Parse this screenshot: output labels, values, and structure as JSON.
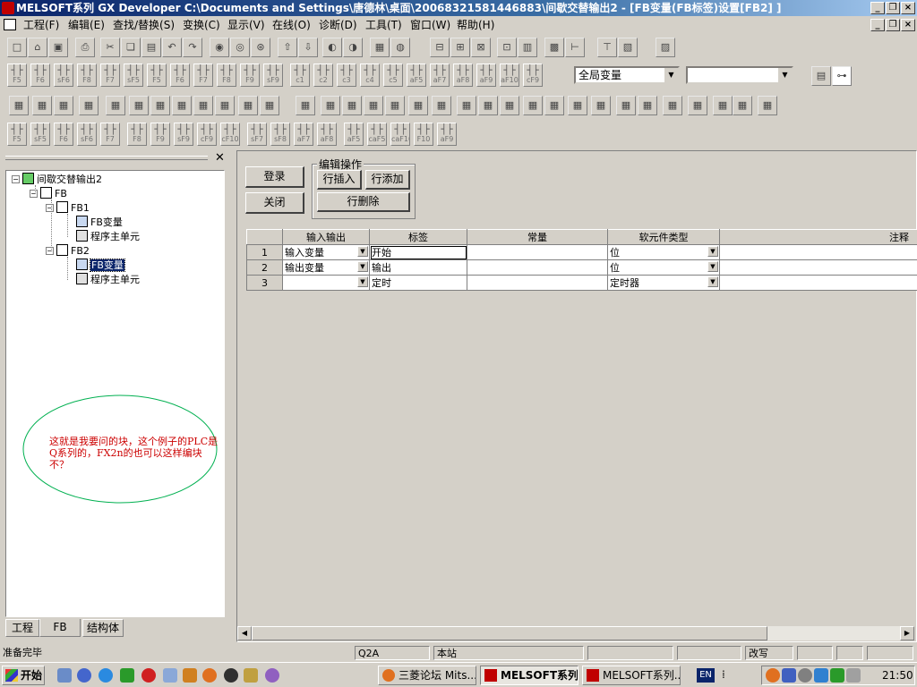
{
  "window": {
    "title": "MELSOFT系列 GX Developer C:\\Documents and Settings\\唐德林\\桌面\\20068321581446883\\间歇交替输出2 - [FB变量(FB标签)设置[FB2] ]"
  },
  "menu": [
    "工程(F)",
    "编辑(E)",
    "查找/替换(S)",
    "变换(C)",
    "显示(V)",
    "在线(O)",
    "诊断(D)",
    "工具(T)",
    "窗口(W)",
    "帮助(H)"
  ],
  "toolbar2": {
    "fkeys": [
      "F5",
      "F6",
      "sF6",
      "F8",
      "F7",
      "sF5",
      "F5",
      "F6",
      "F7",
      "F8",
      "F9",
      "sF9",
      "c1",
      "c2",
      "c3",
      "c4",
      "c5",
      "aF5",
      "aF7",
      "aF8",
      "aF9",
      "aF10",
      "cF9"
    ],
    "scope_select": "全局变量",
    "second_select": ""
  },
  "toolbar4": {
    "fkeys": [
      "F5",
      "sF5",
      "F6",
      "sF6",
      "F7",
      "F8",
      "F9",
      "sF9",
      "cF9",
      "cF10",
      "sF7",
      "sF8",
      "aF7",
      "aF8",
      "aF5",
      "caF5",
      "caF10",
      "F10",
      "aF9"
    ]
  },
  "tree": {
    "root": "间歇交替输出2",
    "fb_folder": "FB",
    "fb1": "FB1",
    "fb1_var": "FB变量",
    "fb1_prog": "程序主单元",
    "fb2": "FB2",
    "fb2_var": "FB变量",
    "fb2_prog": "程序主单元"
  },
  "annotation": "这就是我要问的块，这个例子的PLC是Q系列的，FX2n的也可以这样编块不？",
  "left_tabs": [
    "工程",
    "FB",
    "结构体"
  ],
  "buttons": {
    "register": "登录",
    "close": "关闭",
    "edit_group": "编辑操作",
    "row_insert": "行插入",
    "row_add": "行添加",
    "row_delete": "行删除"
  },
  "table": {
    "headers": [
      "输入输出",
      "标签",
      "常量",
      "软元件类型",
      "注释"
    ],
    "rows": [
      {
        "no": "1",
        "io": "输入变量",
        "label": "开始",
        "const": "",
        "type": "位",
        "comment": ""
      },
      {
        "no": "2",
        "io": "输出变量",
        "label": "输出",
        "const": "",
        "type": "位",
        "comment": ""
      },
      {
        "no": "3",
        "io": "",
        "label": "定时",
        "const": "",
        "type": "定时器",
        "comment": ""
      }
    ]
  },
  "status": {
    "left": "准备完毕",
    "plc": "Q2A",
    "station": "本站",
    "mode": "改写"
  },
  "taskbar": {
    "start": "开始",
    "tasks": [
      "三菱论坛 Mits...",
      "MELSOFT系列...",
      "MELSOFT系列..."
    ],
    "lang": "EN",
    "time": "21:50"
  },
  "colors": {
    "titlebar": "#0a246a",
    "annotation_text": "#cc0000",
    "ellipse": "#00b050",
    "selection": "#0a246a"
  }
}
